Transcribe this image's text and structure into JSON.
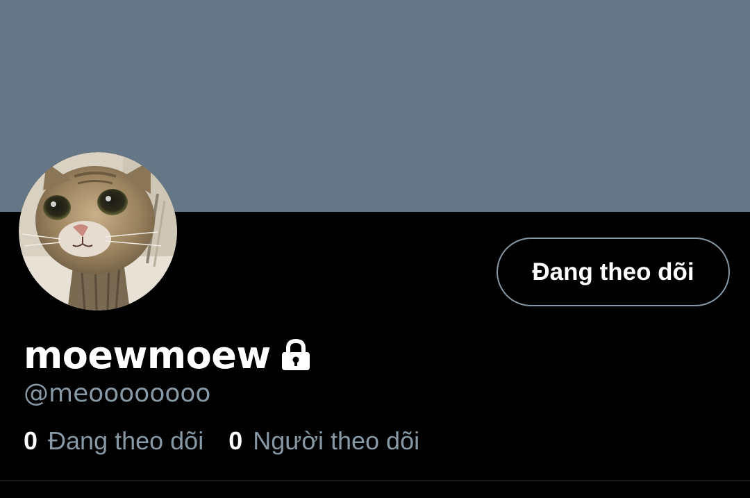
{
  "profile": {
    "display_name": "moewmoew",
    "handle": "@meoooooooo",
    "is_protected": true,
    "follow_button_label": "Đang theo dõi",
    "following": {
      "count": "0",
      "label": "Đang theo dõi"
    },
    "followers": {
      "count": "0",
      "label": "Người theo dõi"
    }
  },
  "icons": {
    "lock": "lock-icon",
    "avatar": "cat-avatar"
  },
  "colors": {
    "banner": "#657786",
    "background": "#000000",
    "secondary_text": "#8899a6",
    "primary_text": "#ffffff",
    "button_border": "#8899a6"
  }
}
